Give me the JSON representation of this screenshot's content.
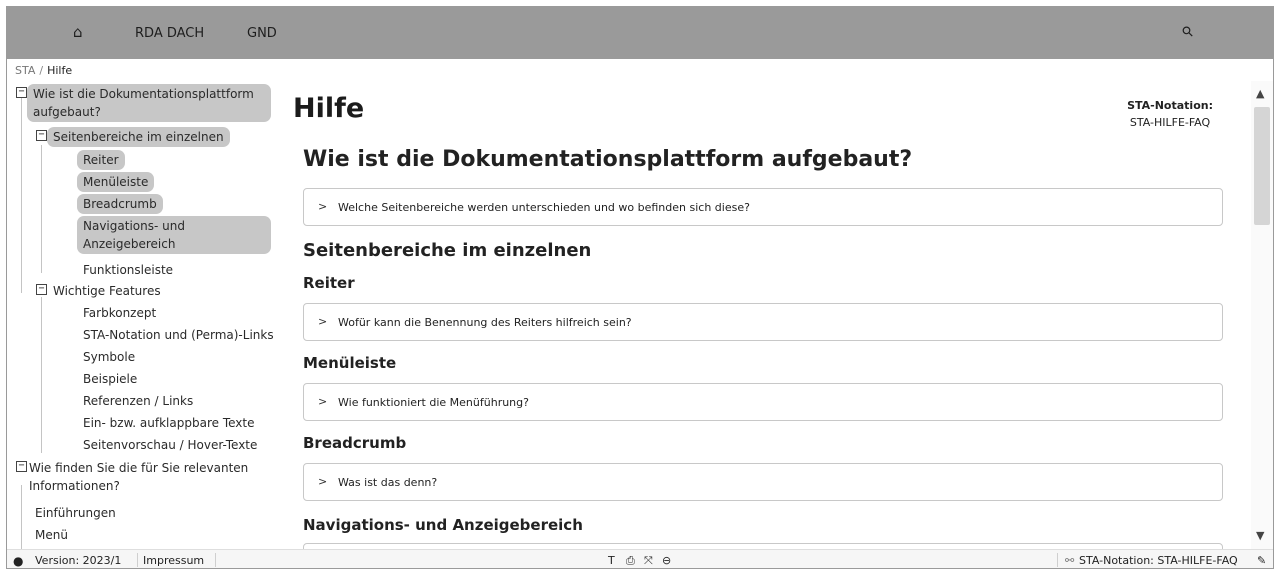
{
  "topnav": {
    "home_icon": "⌂",
    "tabs": [
      "RDA DACH",
      "GND"
    ],
    "search_icon": "⚲"
  },
  "breadcrumb": {
    "root": "STA",
    "separator": "/",
    "current": "Hilfe"
  },
  "sidebar": {
    "toggle_symbol": "−",
    "items": [
      {
        "label": "Wie ist die Dokumentationsplattform aufgebaut?"
      },
      {
        "label": "Seitenbereiche im einzelnen"
      },
      {
        "label": "Reiter"
      },
      {
        "label": "Menüleiste"
      },
      {
        "label": "Breadcrumb"
      },
      {
        "label": "Navigations- und Anzeigebereich"
      },
      {
        "label": "Funktionsleiste"
      },
      {
        "label": "Wichtige Features"
      },
      {
        "label": "Farbkonzept"
      },
      {
        "label": "STA-Notation und (Perma)-Links"
      },
      {
        "label": "Symbole"
      },
      {
        "label": "Beispiele"
      },
      {
        "label": "Referenzen / Links"
      },
      {
        "label": "Ein- bzw. aufklappbare Texte"
      },
      {
        "label": "Seitenvorschau / Hover-Texte"
      },
      {
        "label": "Wie finden Sie die für Sie relevanten Informationen?"
      },
      {
        "label": "Einführungen"
      },
      {
        "label": "Menü"
      }
    ]
  },
  "main": {
    "title": "Hilfe",
    "sta_label": "STA-Notation:",
    "sta_value": "STA-HILFE-FAQ",
    "heading_main": "Wie ist die Dokumentationsplattform aufgebaut?",
    "accordion_1": "Welche Seitenbereiche werden unterschieden und wo befinden sich diese?",
    "heading_sections": "Seitenbereiche im einzelnen",
    "heading_reiter": "Reiter",
    "accordion_reiter": "Wofür kann die Benennung des Reiters hilfreich sein?",
    "heading_menu": "Menüleiste",
    "accordion_menu": "Wie funktioniert die Menüführung?",
    "heading_breadcrumb": "Breadcrumb",
    "accordion_breadcrumb": "Was ist das denn?",
    "heading_nav": "Navigations- und Anzeigebereich",
    "chevron": ">"
  },
  "scrollbar": {
    "up": "▲",
    "down": "▼"
  },
  "footer": {
    "github_icon": "●",
    "version": "Version: 2023/1",
    "impressum": "Impressum",
    "tool_icons": [
      "T",
      "⎙",
      "⤧",
      "⊖"
    ],
    "link_icon": "⚯",
    "sta_notation": "STA-Notation: STA-HILFE-FAQ",
    "edit_icon": "✎"
  }
}
